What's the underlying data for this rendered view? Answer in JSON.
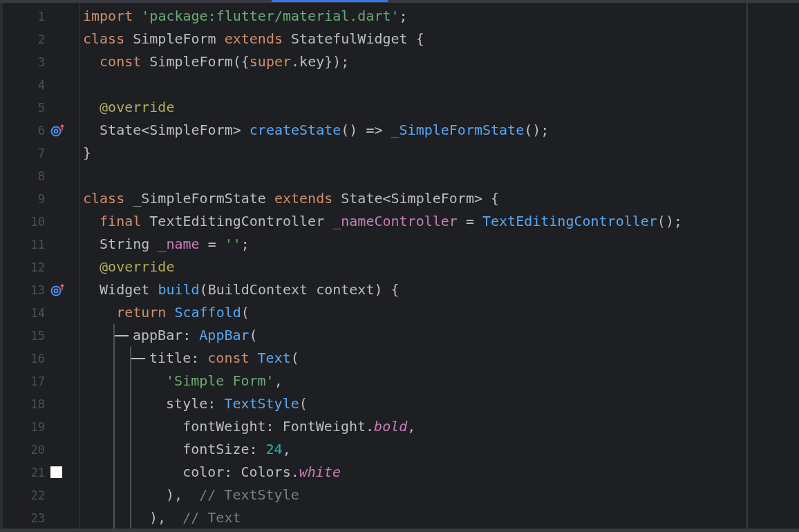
{
  "editor": {
    "lines": [
      {
        "number": "1",
        "tokens": [
          {
            "kind": "keyword",
            "text": "import "
          },
          {
            "kind": "string",
            "text": "'package:flutter/material.dart'"
          },
          {
            "kind": "plain",
            "text": ";"
          }
        ]
      },
      {
        "number": "2",
        "tokens": [
          {
            "kind": "keyword",
            "text": "class "
          },
          {
            "kind": "plain",
            "text": "SimpleForm "
          },
          {
            "kind": "keyword",
            "text": "extends "
          },
          {
            "kind": "plain",
            "text": "StatefulWidget {"
          }
        ]
      },
      {
        "number": "3",
        "tokens": [
          {
            "kind": "keyword",
            "text": "  const "
          },
          {
            "kind": "plain",
            "text": "SimpleForm({"
          },
          {
            "kind": "keyword",
            "text": "super"
          },
          {
            "kind": "plain",
            "text": ".key});"
          }
        ]
      },
      {
        "number": "4"
      },
      {
        "number": "5",
        "tokens": [
          {
            "kind": "annotation",
            "text": "  @override"
          }
        ]
      },
      {
        "number": "6",
        "gutter": {
          "kind": "override"
        },
        "tokens": [
          {
            "kind": "plain",
            "text": "  State<SimpleForm> "
          },
          {
            "kind": "call",
            "text": "createState"
          },
          {
            "kind": "plain",
            "text": "() => "
          },
          {
            "kind": "call",
            "text": "_SimpleFormState"
          },
          {
            "kind": "plain",
            "text": "();"
          }
        ]
      },
      {
        "number": "7",
        "tokens": [
          {
            "kind": "plain",
            "text": "}"
          }
        ]
      },
      {
        "number": "8"
      },
      {
        "number": "9",
        "tokens": [
          {
            "kind": "keyword",
            "text": "class "
          },
          {
            "kind": "plain",
            "text": "_SimpleFormState "
          },
          {
            "kind": "keyword",
            "text": "extends "
          },
          {
            "kind": "plain",
            "text": "State<SimpleForm> {"
          }
        ]
      },
      {
        "number": "10",
        "tokens": [
          {
            "kind": "keyword",
            "text": "  final "
          },
          {
            "kind": "plain",
            "text": "TextEditingController "
          },
          {
            "kind": "field",
            "text": "_nameController"
          },
          {
            "kind": "plain",
            "text": " = "
          },
          {
            "kind": "call",
            "text": "TextEditingController"
          },
          {
            "kind": "plain",
            "text": "();"
          }
        ]
      },
      {
        "number": "11",
        "tokens": [
          {
            "kind": "plain",
            "text": "  String "
          },
          {
            "kind": "field",
            "text": "_name"
          },
          {
            "kind": "plain",
            "text": " = "
          },
          {
            "kind": "string",
            "text": "''"
          },
          {
            "kind": "plain",
            "text": ";"
          }
        ]
      },
      {
        "number": "12",
        "tokens": [
          {
            "kind": "annotation",
            "text": "  @override"
          }
        ]
      },
      {
        "number": "13",
        "gutter": {
          "kind": "override"
        },
        "tokens": [
          {
            "kind": "plain",
            "text": "  Widget "
          },
          {
            "kind": "call",
            "text": "build"
          },
          {
            "kind": "plain",
            "text": "(BuildContext context) {"
          }
        ]
      },
      {
        "number": "14",
        "tokens": [
          {
            "kind": "keyword",
            "text": "    return "
          },
          {
            "kind": "call",
            "text": "Scaffold"
          },
          {
            "kind": "plain",
            "text": "("
          }
        ]
      },
      {
        "number": "15",
        "guides": [
          {
            "kind": "blank"
          },
          {
            "kind": "branch"
          },
          {
            "kind": "blank"
          }
        ],
        "tokens": [
          {
            "kind": "plain",
            "text": "appBar: "
          },
          {
            "kind": "call",
            "text": "AppBar"
          },
          {
            "kind": "plain",
            "text": "("
          }
        ]
      },
      {
        "number": "16",
        "guides": [
          {
            "kind": "blank"
          },
          {
            "kind": "pipe"
          },
          {
            "kind": "branch"
          },
          {
            "kind": "blank"
          }
        ],
        "tokens": [
          {
            "kind": "plain",
            "text": "title: "
          },
          {
            "kind": "keyword",
            "text": "const "
          },
          {
            "kind": "call",
            "text": "Text"
          },
          {
            "kind": "plain",
            "text": "("
          }
        ]
      },
      {
        "number": "17",
        "guides": [
          {
            "kind": "blank"
          },
          {
            "kind": "pipe"
          },
          {
            "kind": "pipe"
          },
          {
            "kind": "blank"
          }
        ],
        "tokens": [
          {
            "kind": "string",
            "text": "  'Simple Form'"
          },
          {
            "kind": "plain",
            "text": ","
          }
        ]
      },
      {
        "number": "18",
        "guides": [
          {
            "kind": "blank"
          },
          {
            "kind": "pipe"
          },
          {
            "kind": "pipe"
          },
          {
            "kind": "blank"
          }
        ],
        "tokens": [
          {
            "kind": "plain",
            "text": "  style: "
          },
          {
            "kind": "call",
            "text": "TextStyle"
          },
          {
            "kind": "plain",
            "text": "("
          }
        ]
      },
      {
        "number": "19",
        "guides": [
          {
            "kind": "blank"
          },
          {
            "kind": "pipe"
          },
          {
            "kind": "pipe"
          },
          {
            "kind": "blank"
          }
        ],
        "tokens": [
          {
            "kind": "plain",
            "text": "    fontWeight: FontWeight."
          },
          {
            "kind": "constant",
            "text": "bold"
          },
          {
            "kind": "plain",
            "text": ","
          }
        ]
      },
      {
        "number": "20",
        "guides": [
          {
            "kind": "blank"
          },
          {
            "kind": "pipe"
          },
          {
            "kind": "pipe"
          },
          {
            "kind": "blank"
          }
        ],
        "tokens": [
          {
            "kind": "plain",
            "text": "    fontSize: "
          },
          {
            "kind": "number",
            "text": "24"
          },
          {
            "kind": "plain",
            "text": ","
          }
        ]
      },
      {
        "number": "21",
        "gutter": {
          "kind": "color",
          "color": "#ffffff"
        },
        "guides": [
          {
            "kind": "blank"
          },
          {
            "kind": "pipe"
          },
          {
            "kind": "pipe"
          },
          {
            "kind": "blank"
          }
        ],
        "tokens": [
          {
            "kind": "plain",
            "text": "    color: Colors."
          },
          {
            "kind": "constant",
            "text": "white"
          }
        ]
      },
      {
        "number": "22",
        "guides": [
          {
            "kind": "blank"
          },
          {
            "kind": "pipe"
          },
          {
            "kind": "pipe"
          },
          {
            "kind": "blank"
          }
        ],
        "tokens": [
          {
            "kind": "plain",
            "text": "  ),  "
          },
          {
            "kind": "comment",
            "text": "// TextStyle"
          }
        ]
      },
      {
        "number": "23",
        "guides": [
          {
            "kind": "blank"
          },
          {
            "kind": "pipe"
          },
          {
            "kind": "pipe"
          },
          {
            "kind": "blank"
          }
        ],
        "tokens": [
          {
            "kind": "plain",
            "text": "),  "
          },
          {
            "kind": "comment",
            "text": "// Text"
          }
        ]
      }
    ]
  }
}
